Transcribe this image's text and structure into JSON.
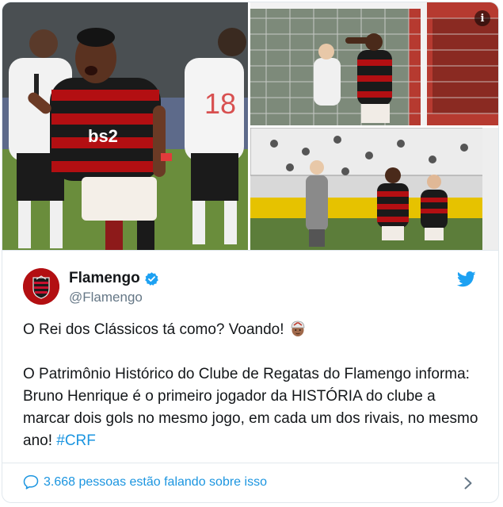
{
  "media": {
    "info_icon": "info-icon",
    "photos": [
      {
        "name": "photo-main",
        "jersey_text": "bs2"
      },
      {
        "name": "photo-goal-net"
      },
      {
        "name": "photo-celebration"
      }
    ]
  },
  "tweet": {
    "author": {
      "display_name": "Flamengo",
      "handle": "@Flamengo",
      "verified_icon": "verified-badge-icon",
      "avatar": "flamengo-crest"
    },
    "platform_icon": "twitter-bird-icon",
    "paragraph1": "O Rei dos Clássicos tá como? Voando!",
    "paragraph1_emoji": "man-in-helmet-emoji",
    "paragraph2": "O Patrimônio Histórico do Clube de Regatas do Flamengo informa: Bruno Henrique é o primeiro jogador da HISTÓRIA do clube a marcar dois gols no mesmo jogo, em cada um dos rivais, no mesmo ano!",
    "hashtag": "#CRF"
  },
  "footer": {
    "conversation_text": "3.668 pessoas estão falando sobre isso",
    "comment_icon": "speech-bubble-icon",
    "chevron_icon": "chevron-right-icon"
  },
  "colors": {
    "link": "#1b95e0",
    "secondary_text": "#657786",
    "border": "#e1e8ed",
    "flamengo_red": "#b30f12"
  }
}
